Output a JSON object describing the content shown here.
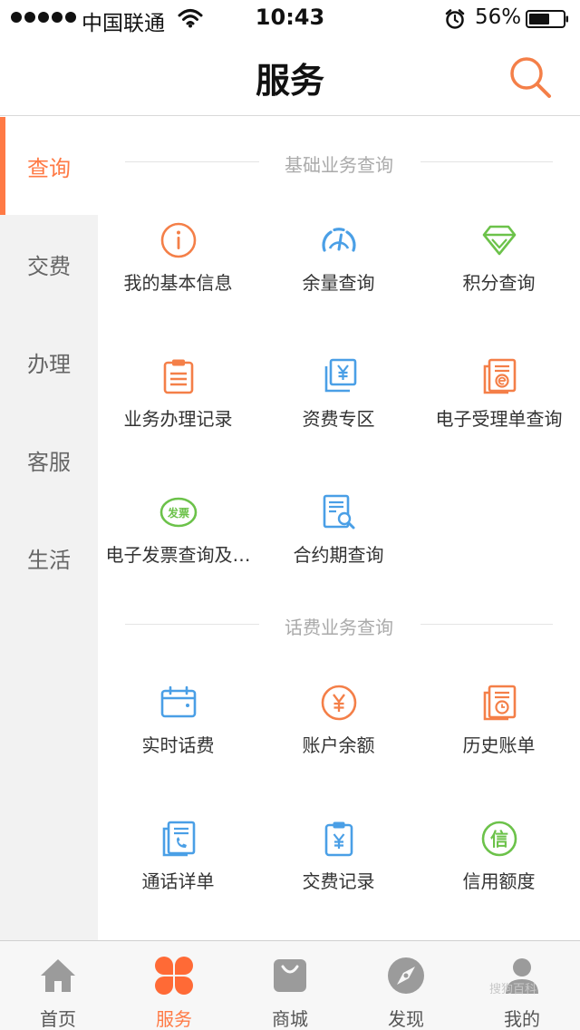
{
  "status_bar": {
    "carrier": "中国联通",
    "time": "10:43",
    "battery": "56%"
  },
  "header": {
    "title": "服务"
  },
  "sidebar": {
    "items": [
      {
        "label": "查询",
        "active": true
      },
      {
        "label": "交费",
        "active": false
      },
      {
        "label": "办理",
        "active": false
      },
      {
        "label": "客服",
        "active": false
      },
      {
        "label": "生活",
        "active": false
      }
    ]
  },
  "sections": [
    {
      "title": "基础业务查询",
      "items": [
        {
          "label": "我的基本信息",
          "icon": "info-circle-icon"
        },
        {
          "label": "余量查询",
          "icon": "gauge-icon"
        },
        {
          "label": "积分查询",
          "icon": "diamond-icon"
        },
        {
          "label": "业务办理记录",
          "icon": "clipboard-icon"
        },
        {
          "label": "资费专区",
          "icon": "yuan-stack-icon"
        },
        {
          "label": "电子受理单查询",
          "icon": "e-document-icon"
        },
        {
          "label": "电子发票查询及…",
          "icon": "invoice-badge-icon",
          "badge_text": "发票"
        },
        {
          "label": "合约期查询",
          "icon": "document-search-icon"
        }
      ]
    },
    {
      "title": "话费业务查询",
      "items": [
        {
          "label": "实时话费",
          "icon": "calendar-icon"
        },
        {
          "label": "账户余额",
          "icon": "yuan-circle-icon"
        },
        {
          "label": "历史账单",
          "icon": "history-bill-icon"
        },
        {
          "label": "通话详单",
          "icon": "call-detail-icon"
        },
        {
          "label": "交费记录",
          "icon": "payment-record-icon"
        },
        {
          "label": "信用额度",
          "icon": "credit-circle-icon",
          "badge_text": "信"
        }
      ]
    }
  ],
  "tab_bar": {
    "items": [
      {
        "label": "首页",
        "icon": "home-icon"
      },
      {
        "label": "服务",
        "icon": "clover-icon",
        "active": true
      },
      {
        "label": "商城",
        "icon": "shopping-bag-icon"
      },
      {
        "label": "发现",
        "icon": "compass-icon"
      },
      {
        "label": "我的",
        "icon": "user-icon"
      }
    ]
  },
  "watermark": "搜狗百科",
  "colors": {
    "accent": "#ff7a45",
    "blue": "#4a9fe6",
    "green": "#6cc24a",
    "tab_inactive": "#9b9b9b"
  }
}
